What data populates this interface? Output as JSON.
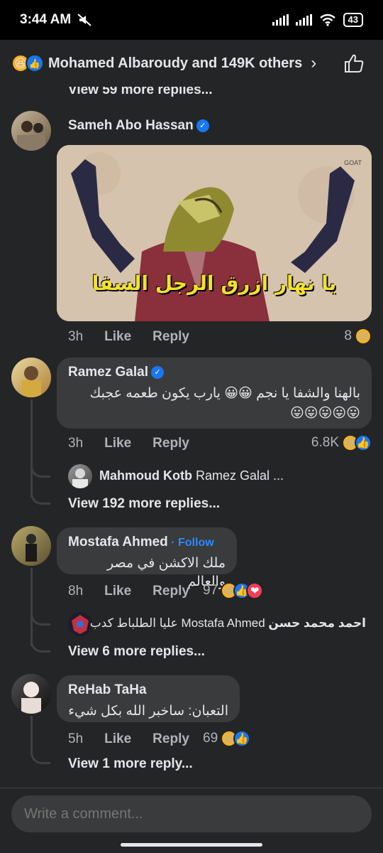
{
  "status": {
    "time": "3:44 AM",
    "battery": "43"
  },
  "header": {
    "reactors": "Mohamed Albaroudy and 149K others"
  },
  "top_more_replies": "View 59 more replies...",
  "comments": [
    {
      "author": "Sameh Abo Hassan",
      "image_caption": "يا نهار ازرق الرجل السقا",
      "image_watermark": "GOAT",
      "time": "3h",
      "like": "Like",
      "reply": "Reply",
      "reactions": "8"
    },
    {
      "author": "Ramez Galal",
      "text": "بالهنا والشفا يا نجم 😀😀 يارب يكون طعمه عجبك",
      "emoji_line": "😛😛😛😛😛",
      "time": "3h",
      "like": "Like",
      "reply": "Reply",
      "reactions": "6.8K",
      "reply_preview": {
        "author": "Mahmoud Kotb",
        "text": "Ramez Galal ..."
      },
      "more_replies": "View 192 more replies..."
    },
    {
      "author": "Mostafa Ahmed",
      "follow": "Follow",
      "separator": "·",
      "text": "ملك الاكشن في مصر والعالم",
      "time": "8h",
      "like": "Like",
      "reply": "Reply",
      "reactions": "97",
      "reply_preview": {
        "author": "احمد محمد حسن",
        "text": "Mostafa Ahmed عليا الطلباط كدب"
      },
      "more_replies": "View 6 more replies..."
    },
    {
      "author": "ReHab TaHa",
      "text": "التعبان: ساخبر الله بكل شيء",
      "time": "5h",
      "like": "Like",
      "reply": "Reply",
      "reactions": "69",
      "more_replies": "View 1 more reply..."
    }
  ],
  "composer": {
    "placeholder": "Write a comment..."
  },
  "colors": {
    "accent": "#1877f2",
    "bg": "#242526",
    "bubble": "#3a3b3c",
    "haha": "#f7b125",
    "love": "#f33e58"
  }
}
